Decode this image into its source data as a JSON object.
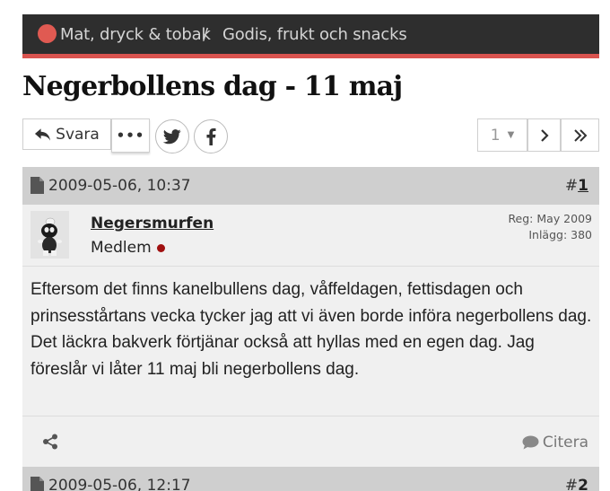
{
  "breadcrumb": {
    "items": [
      "Mat, dryck & tobak",
      "Godis, frukt och snacks"
    ],
    "separator": "/"
  },
  "thread": {
    "title": "Negerbollens dag - 11 maj"
  },
  "toolbar": {
    "reply_label": "Svara",
    "more_label": "•••"
  },
  "pager": {
    "current_page": "1"
  },
  "posts": [
    {
      "date": "2009-05-06, 10:37",
      "number_prefix": "#",
      "number": "1",
      "author": "Negersmurfen",
      "role": "Medlem",
      "reg": "Reg: May 2009",
      "posts_count": "Inlägg: 380",
      "text": "Eftersom det finns kanelbullens dag, våffeldagen, fettisdagen och prinsesstårtans vecka tycker jag att vi även borde införa negerbollens dag. Det läckra bakverk förtjänar också att hyllas med en egen dag. Jag föreslår vi låter 11 maj bli negerbollens dag.",
      "quote_label": "Citera"
    },
    {
      "date": "2009-05-06, 12:17",
      "number_prefix": "#",
      "number": "2"
    }
  ],
  "colors": {
    "topbar": "#2e2e2e",
    "accent": "#d9534f",
    "online": "#a01010"
  }
}
